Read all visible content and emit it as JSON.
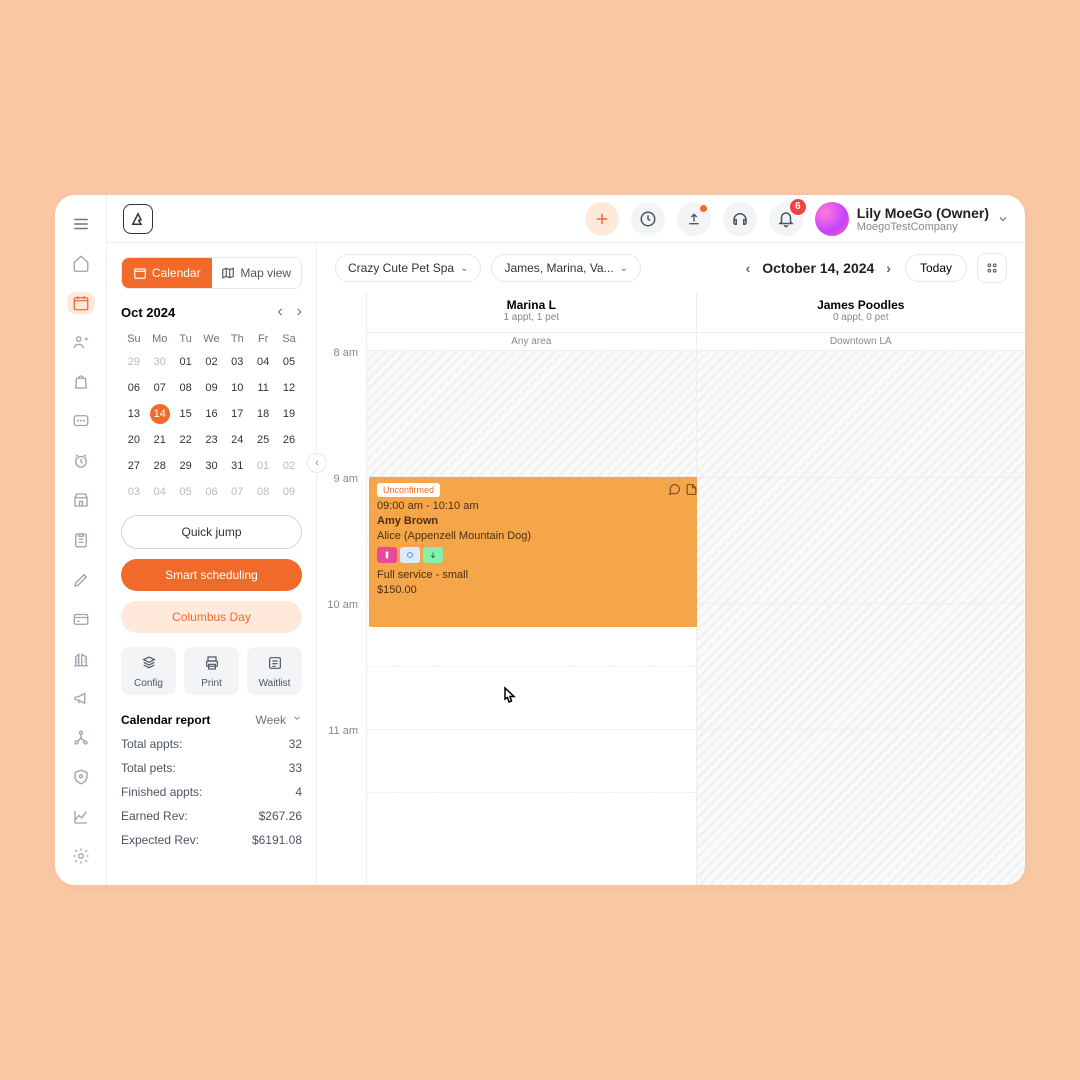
{
  "user": {
    "name": "Lily MoeGo (Owner)",
    "company": "MoegoTestCompany"
  },
  "notifications": {
    "count": "6"
  },
  "seg": {
    "calendar": "Calendar",
    "map": "Map view"
  },
  "mini": {
    "label": "Oct 2024",
    "dow": [
      "Su",
      "Mo",
      "Tu",
      "We",
      "Th",
      "Fr",
      "Sa"
    ],
    "weeks": [
      [
        {
          "d": "29",
          "m": 1
        },
        {
          "d": "30",
          "m": 1
        },
        {
          "d": "01"
        },
        {
          "d": "02"
        },
        {
          "d": "03"
        },
        {
          "d": "04"
        },
        {
          "d": "05"
        }
      ],
      [
        {
          "d": "06"
        },
        {
          "d": "07"
        },
        {
          "d": "08"
        },
        {
          "d": "09"
        },
        {
          "d": "10"
        },
        {
          "d": "11"
        },
        {
          "d": "12"
        }
      ],
      [
        {
          "d": "13"
        },
        {
          "d": "14",
          "sel": 1
        },
        {
          "d": "15"
        },
        {
          "d": "16"
        },
        {
          "d": "17"
        },
        {
          "d": "18"
        },
        {
          "d": "19"
        }
      ],
      [
        {
          "d": "20"
        },
        {
          "d": "21"
        },
        {
          "d": "22"
        },
        {
          "d": "23"
        },
        {
          "d": "24"
        },
        {
          "d": "25"
        },
        {
          "d": "26"
        }
      ],
      [
        {
          "d": "27"
        },
        {
          "d": "28"
        },
        {
          "d": "29"
        },
        {
          "d": "30"
        },
        {
          "d": "31"
        },
        {
          "d": "01",
          "m": 1
        },
        {
          "d": "02",
          "m": 1
        }
      ],
      [
        {
          "d": "03",
          "m": 1
        },
        {
          "d": "04",
          "m": 1
        },
        {
          "d": "05",
          "m": 1
        },
        {
          "d": "06",
          "m": 1
        },
        {
          "d": "07",
          "m": 1
        },
        {
          "d": "08",
          "m": 1
        },
        {
          "d": "09",
          "m": 1
        }
      ]
    ]
  },
  "buttons": {
    "quick": "Quick jump",
    "smart": "Smart scheduling",
    "holiday": "Columbus Day"
  },
  "tools": {
    "config": "Config",
    "print": "Print",
    "wait": "Waitlist"
  },
  "report": {
    "title": "Calendar report",
    "period": "Week",
    "rows": [
      {
        "label": "Total appts:",
        "value": "32"
      },
      {
        "label": "Total pets:",
        "value": "33"
      },
      {
        "label": "Finished appts:",
        "value": "4"
      },
      {
        "label": "Earned Rev:",
        "value": "$267.26"
      },
      {
        "label": "Expected Rev:",
        "value": "$6191.08"
      }
    ]
  },
  "filters": {
    "location": "Crazy Cute Pet Spa",
    "staff": "James, Marina, Va..."
  },
  "date": {
    "label": "October 14, 2024",
    "today": "Today"
  },
  "staff": [
    {
      "name": "Marina L",
      "sub": "1 appt, 1 pet",
      "area": "Any area"
    },
    {
      "name": "James Poodles",
      "sub": "0 appt, 0 pet",
      "area": "Downtown LA"
    }
  ],
  "times": [
    "8 am",
    "9 am",
    "10 am",
    "11 am"
  ],
  "appt": {
    "status": "Unconfirmed",
    "time": "09:00 am - 10:10 am",
    "client": "Amy Brown",
    "pet": "Alice (Appenzell Mountain Dog)",
    "service": "Full service - small",
    "price": "$150.00"
  }
}
